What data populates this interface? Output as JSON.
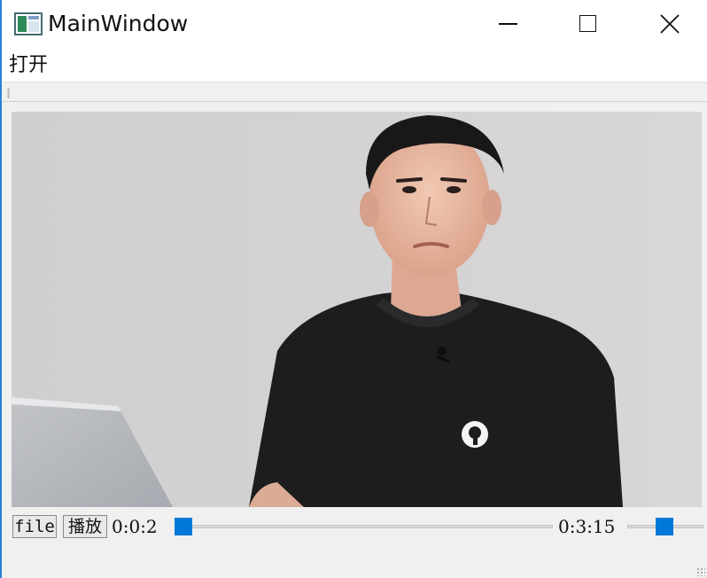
{
  "window": {
    "title": "MainWindow",
    "app_icon": "qt-window-icon",
    "controls": [
      "minimize-icon",
      "maximize-icon",
      "close-icon"
    ]
  },
  "menubar": {
    "items": [
      {
        "label": "打开"
      }
    ]
  },
  "video": {
    "frame_description_icon": "video-frame"
  },
  "controls": {
    "file_button": "file",
    "play_button": "播放",
    "current_time": "0:0:2",
    "total_time": "0:3:15",
    "seek_position": 0.0,
    "volume_position": 0.5
  },
  "colors": {
    "accent": "#0078d7",
    "window_bg": "#f0f0f0",
    "titlebar_bg": "#ffffff"
  }
}
